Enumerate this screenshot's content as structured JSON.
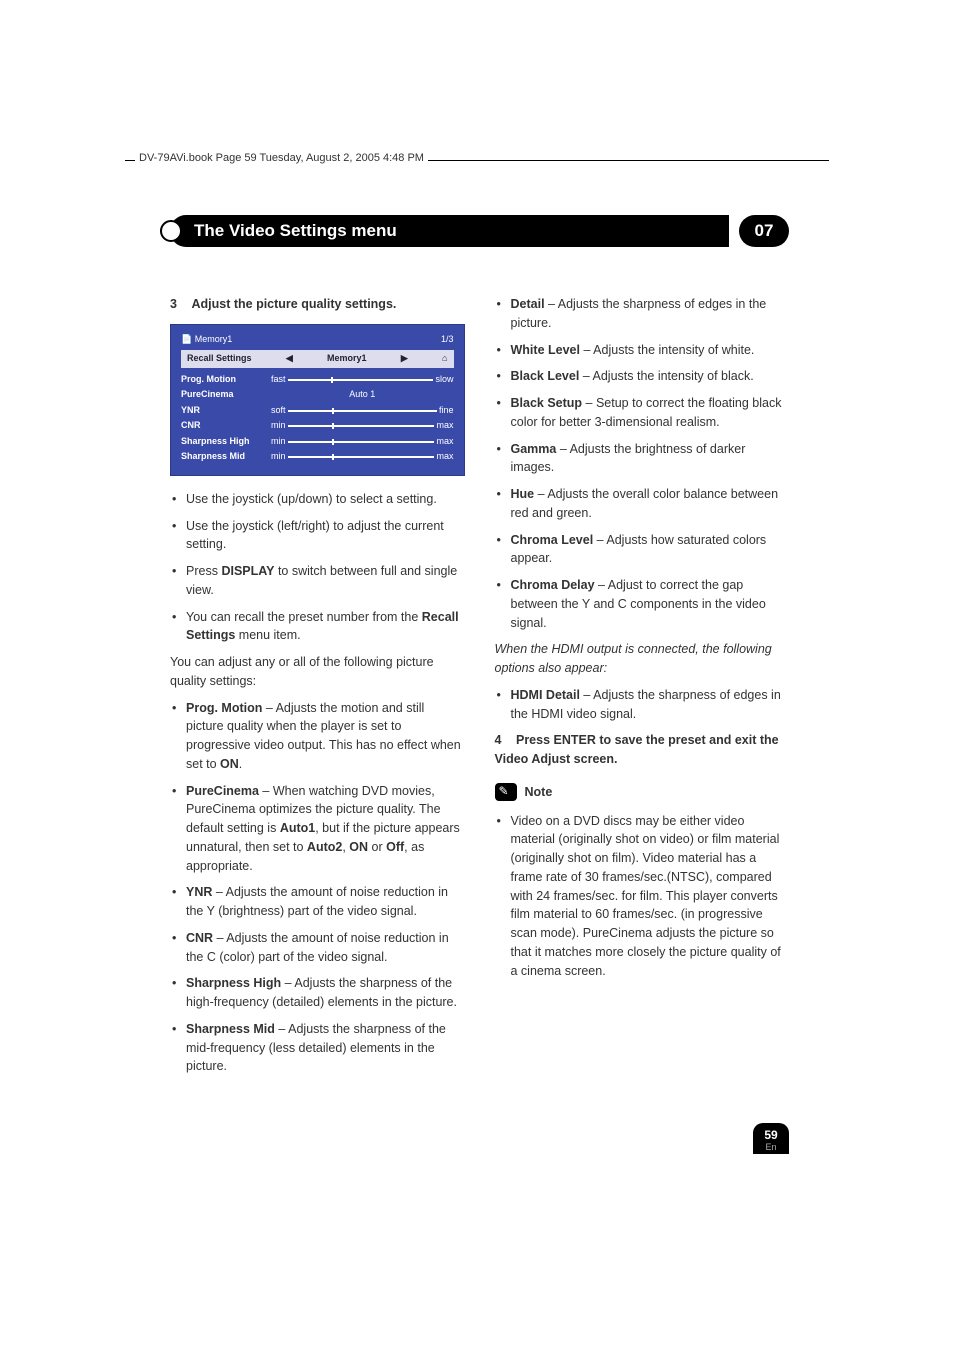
{
  "top_header": "DV-79AVi.book  Page 59  Tuesday, August 2, 2005  4:48 PM",
  "titlebar": {
    "left": "The Video Settings menu",
    "right": "07"
  },
  "step3": {
    "num": "3",
    "text": "Adjust the picture quality settings."
  },
  "osd": {
    "title": "Memory1",
    "page": "1/3",
    "header_left": "Recall Settings",
    "header_mid": "Memory1",
    "rows": [
      {
        "label": "Prog. Motion",
        "left": "fast",
        "right": "slow"
      },
      {
        "label": "PureCinema",
        "center": "Auto 1"
      },
      {
        "label": "YNR",
        "left": "soft",
        "right": "fine"
      },
      {
        "label": "CNR",
        "left": "min",
        "right": "max"
      },
      {
        "label": "Sharpness High",
        "left": "min",
        "right": "max"
      },
      {
        "label": "Sharpness Mid",
        "left": "min",
        "right": "max"
      }
    ]
  },
  "col1_bullets1": [
    "Use the joystick (up/down) to select a setting.",
    "Use the joystick (left/right) to adjust the current setting.",
    "Press DISPLAY to switch between full and single view.",
    "You can recall the preset number from the Recall Settings menu item."
  ],
  "col1_para": "You can adjust any or all of the following picture quality settings:",
  "col1_bullets2": [
    {
      "b": "Prog. Motion",
      "t": " – Adjusts the motion and still picture quality when the player is set to progressive video output. This has no effect when set to ",
      "b2": "ON",
      "t2": "."
    },
    {
      "b": "PureCinema",
      "t": " – When watching DVD movies, PureCinema optimizes the picture quality. The default setting is ",
      "b2": "Auto1",
      "t2": ", but if the picture appears unnatural, then set to ",
      "b3": "Auto2",
      "t3": ", ",
      "b4": "ON",
      "t4": " or ",
      "b5": "Off",
      "t5": ", as appropriate."
    },
    {
      "b": "YNR",
      "t": " – Adjusts the amount of noise reduction in the Y (brightness) part of the video signal."
    },
    {
      "b": "CNR",
      "t": " – Adjusts the amount of noise reduction in the C (color) part of the video signal."
    },
    {
      "b": "Sharpness High",
      "t": " – Adjusts the sharpness of the high-frequency (detailed) elements in the picture."
    },
    {
      "b": "Sharpness Mid",
      "t": " – Adjusts the sharpness of the mid-frequency (less detailed) elements in the picture."
    }
  ],
  "col2_bullets1": [
    {
      "b": "Detail",
      "t": " – Adjusts the sharpness of edges in the picture."
    },
    {
      "b": "White Level",
      "t": " – Adjusts the intensity of white."
    },
    {
      "b": "Black Level",
      "t": " – Adjusts the intensity of black."
    },
    {
      "b": "Black Setup",
      "t": " – Setup to correct the floating black color for better 3-dimensional realism."
    },
    {
      "b": "Gamma",
      "t": " – Adjusts the brightness of darker images."
    },
    {
      "b": "Hue",
      "t": " – Adjusts the overall color balance between red and green."
    },
    {
      "b": "Chroma Level",
      "t": " – Adjusts how saturated colors appear."
    },
    {
      "b": "Chroma Delay",
      "t": " – Adjust to correct the gap between the Y and C components in the video signal."
    }
  ],
  "col2_italic": "When the HDMI output is connected, the following options also appear:",
  "col2_bullets2": [
    {
      "b": "HDMI Detail",
      "t": " – Adjusts the sharpness of edges in the HDMI video signal."
    }
  ],
  "step4": {
    "num": "4",
    "text": "Press ENTER to save the preset and exit the Video Adjust screen."
  },
  "note_label": "Note",
  "note_bullet": "Video on a DVD discs may be either video material (originally shot on video) or film material (originally shot on film). Video material has a frame rate of 30 frames/sec.(NTSC), compared with 24 frames/sec. for film. This player converts film material to 60 frames/sec. (in progressive scan mode). PureCinema adjusts the picture so that it matches more closely the picture quality of a cinema screen.",
  "pagenum": {
    "num": "59",
    "lang": "En"
  }
}
